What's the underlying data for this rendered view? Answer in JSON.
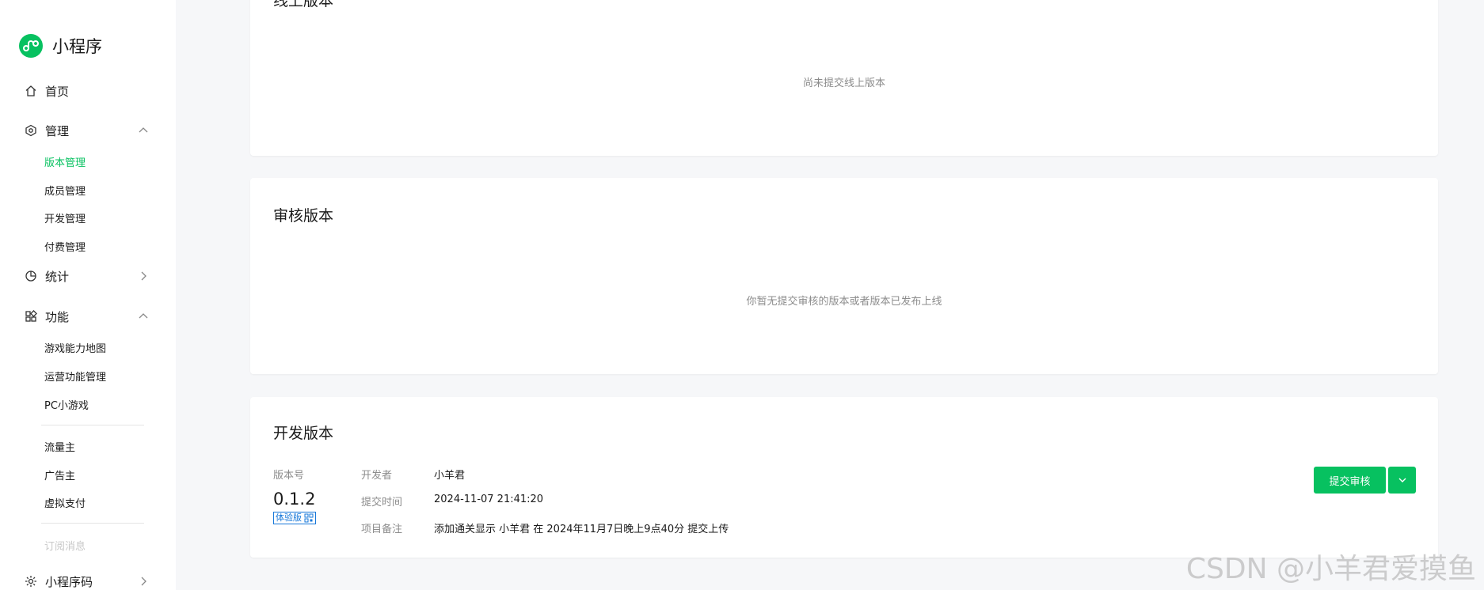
{
  "sidebar": {
    "brand": "小程序",
    "home": "首页",
    "manage": {
      "label": "管理",
      "items": [
        "版本管理",
        "成员管理",
        "开发管理",
        "付费管理"
      ]
    },
    "stats": "统计",
    "features": {
      "label": "功能",
      "items": [
        "游戏能力地图",
        "运营功能管理",
        "PC小游戏"
      ],
      "items2": [
        "流量主",
        "广告主",
        "虚拟支付"
      ],
      "faded_item": "订阅消息"
    },
    "qrcode": "小程序码"
  },
  "online_version": {
    "title": "线上版本",
    "empty": "尚未提交线上版本"
  },
  "review_version": {
    "title": "审核版本",
    "empty": "你暂无提交审核的版本或者版本已发布上线"
  },
  "dev_version": {
    "title": "开发版本",
    "version_label": "版本号",
    "version": "0.1.2",
    "badge": "体验版",
    "developer_label": "开发者",
    "developer": "小羊君",
    "submit_time_label": "提交时间",
    "submit_time": "2024-11-07 21:41:20",
    "note_label": "项目备注",
    "note": "添加通关显示 小羊君 在 2024年11月7日晚上9点40分 提交上传",
    "submit_button": "提交审核"
  },
  "watermark": "CSDN @小羊君爱摸鱼",
  "colors": {
    "accent": "#07c160",
    "badge": "#1677d9",
    "muted": "#8c8c8c"
  }
}
